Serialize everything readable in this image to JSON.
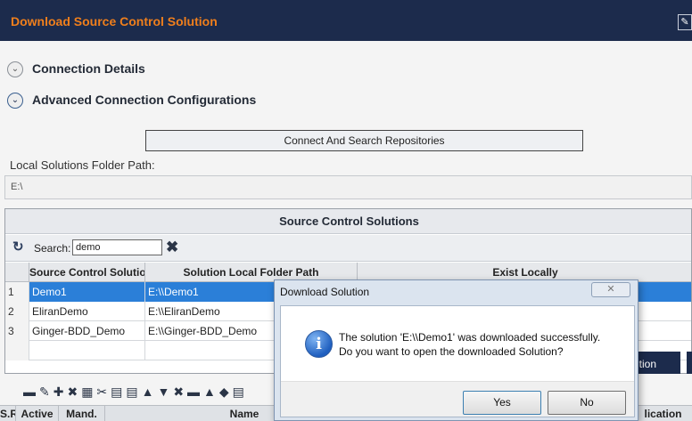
{
  "window": {
    "title": "Download Source Control Solution",
    "pin_icon": "pin-icon"
  },
  "sections": [
    {
      "label": "Connection Details",
      "state": "collapsed"
    },
    {
      "label": "Advanced Connection Configurations",
      "state": "expanded"
    }
  ],
  "connect_button": "Connect And Search Repositories",
  "local_path": {
    "label": "Local Solutions Folder Path:",
    "value": "E:\\"
  },
  "grid": {
    "title": "Source Control Solutions",
    "search_label": "Search:",
    "search_value": "demo",
    "columns": [
      "Source Control Solutio",
      "Solution Local Folder Path",
      "Exist Locally"
    ],
    "rows": [
      {
        "index": "1",
        "name": "Demo1",
        "path": "E:\\\\Demo1",
        "selected": true
      },
      {
        "index": "2",
        "name": "EliranDemo",
        "path": "E:\\\\EliranDemo",
        "selected": false
      },
      {
        "index": "3",
        "name": "Ginger-BDD_Demo",
        "path": "E:\\\\Ginger-BDD_Demo",
        "selected": false
      }
    ]
  },
  "background_button": "tion",
  "lower_grid": {
    "columns": [
      "S.R",
      "Active",
      "Mand.",
      "Name",
      "lication"
    ]
  },
  "dialog": {
    "title": "Download Solution",
    "message_line1": "The solution 'E:\\\\Demo1' was downloaded successfully.",
    "message_line2": "Do you want to open the downloaded Solution?",
    "yes_label": "Yes",
    "no_label": "No",
    "icon": "info-icon"
  },
  "colors": {
    "title_bar": "#1c2b4c",
    "title_text": "#f07f1c",
    "selection": "#2b7fd8"
  }
}
